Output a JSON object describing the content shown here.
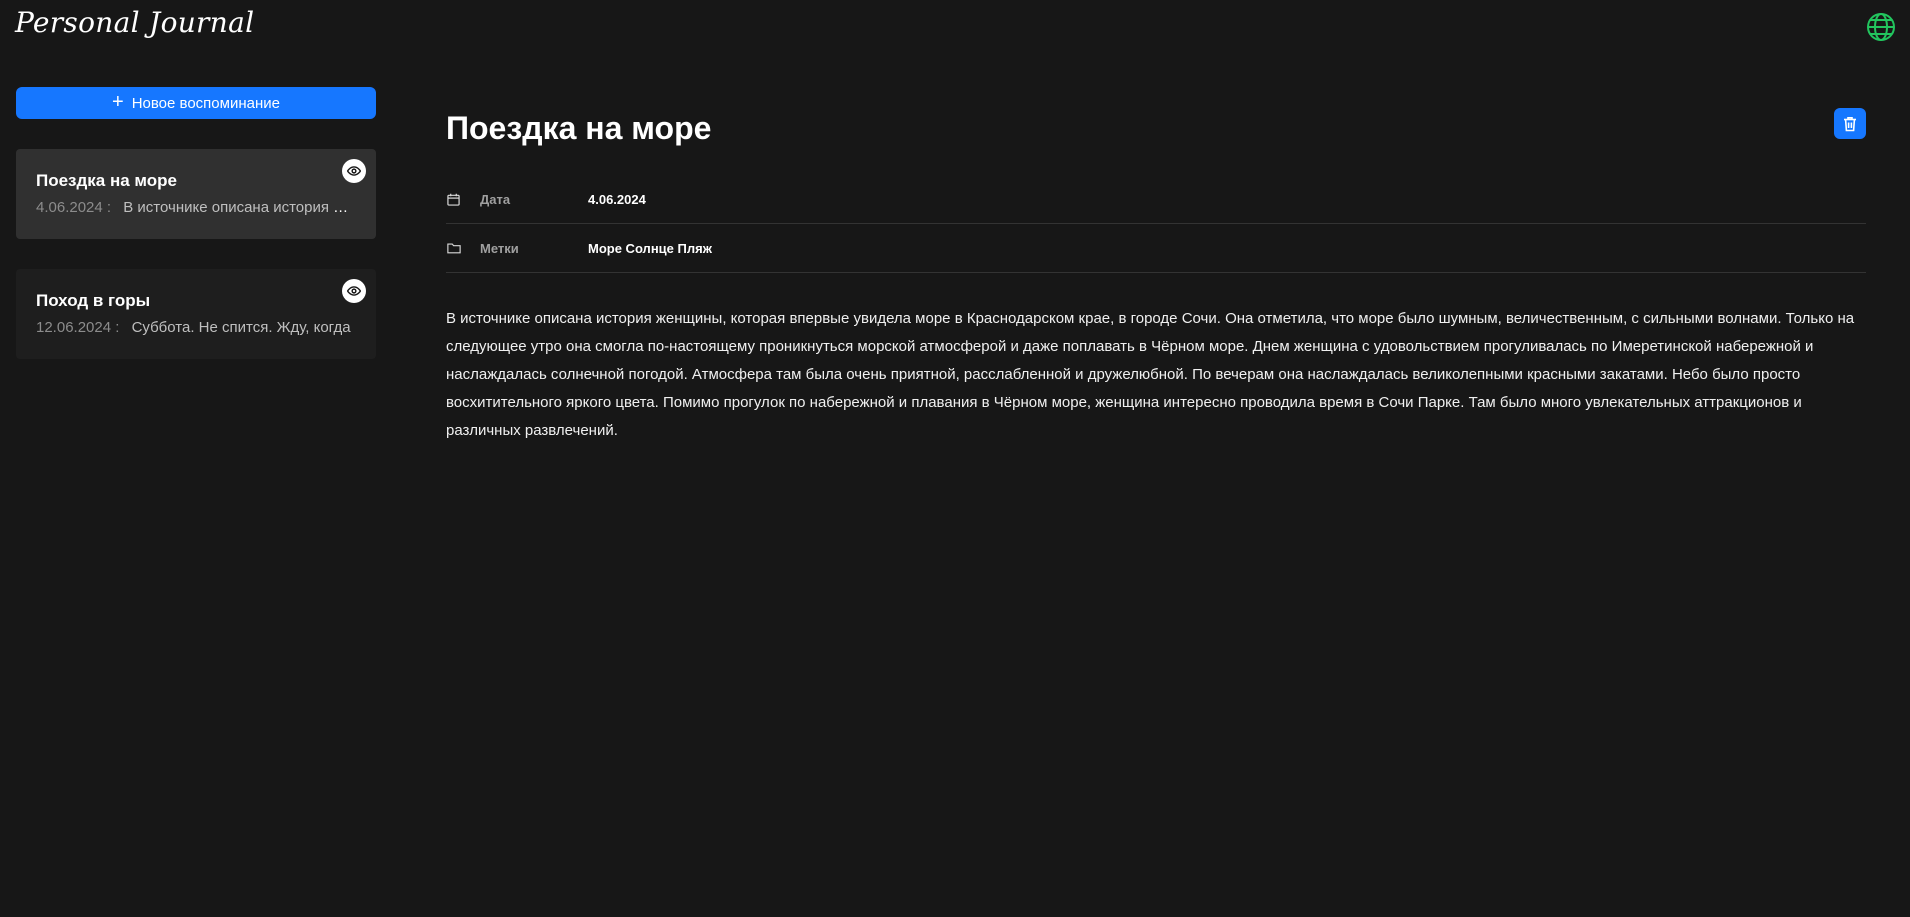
{
  "app": {
    "title": "Personal Journal",
    "accent_color": "#1677ff",
    "globe_color": "#22c55e",
    "language_icon": "globe-icon"
  },
  "sidebar": {
    "new_button_label": "Новое воспоминание",
    "entries": [
      {
        "title": "Поездка на море",
        "date": "4.06.2024",
        "separator": ":",
        "excerpt": "В источнике описана история женщины, которая впервые увидела море в Краснодарском крае",
        "active": true
      },
      {
        "title": "Поход в горы",
        "date": "12.06.2024",
        "separator": ":",
        "excerpt": "Суббота. Не спится. Жду, когда",
        "active": false
      }
    ]
  },
  "entry": {
    "title": "Поездка на море",
    "date_label": "Дата",
    "date_value": "4.06.2024",
    "tags_label": "Метки",
    "tags_value": "Море Солнце Пляж",
    "text": "В источнике описана история женщины, которая впервые увидела море в Краснодарском крае, в городе Сочи. Она отметила, что море было шумным, величественным, с сильными волнами. Только на следующее утро она смогла по-настоящему проникнуться морской атмосферой и даже поплавать в Чёрном море. Днем женщина с удовольствием прогуливалась по Имеретинской набережной и наслаждалась солнечной погодой. Атмосфера там была очень приятной, расслабленной и дружелюбной. По вечерам она наслаждалась великолепными красными закатами. Небо было просто восхитительного яркого цвета. Помимо прогулок по набережной и плавания в Чёрном море, женщина интересно проводила время в Сочи Парке. Там было много увлекательных аттракционов и различных развлечений."
  }
}
